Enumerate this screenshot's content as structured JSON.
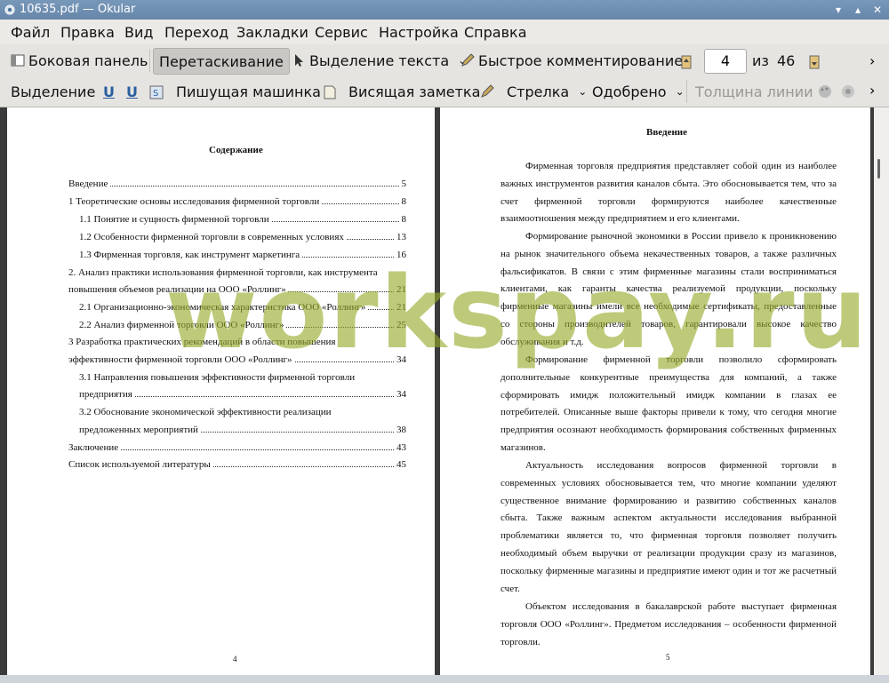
{
  "window": {
    "title": "10635.pdf — Okular"
  },
  "menubar": {
    "items": [
      "Файл",
      "Правка",
      "Вид",
      "Переход",
      "Закладки",
      "Сервис",
      "Настройка",
      "Справка"
    ]
  },
  "toolbar1": {
    "sidebar_label": "Боковая панель",
    "drag_label": "Перетаскивание",
    "text_select_label": "Выделение текста",
    "quick_comment_label": "Быстрое комментирование",
    "current_page": "4",
    "of_label": "из",
    "total_pages": "46"
  },
  "toolbar2": {
    "select_label": "Выделение",
    "typewriter_label": "Пишущая машинка",
    "sticky_note_label": "Висящая заметка",
    "arrow_label": "Стрелка",
    "approved_label": "Одобрено",
    "line_width_label": "Толщина линии"
  },
  "left_page": {
    "title": "Содержание",
    "toc": [
      {
        "text": "Введение",
        "page": "5"
      },
      {
        "text": "1    Теоретические основы исследования фирменной торговли",
        "page": "8"
      },
      {
        "text": "1.1 Понятие и сущность фирменной торговли",
        "page": "8"
      },
      {
        "text": "1.2 Особенности фирменной торговли в современных условиях",
        "page": "13"
      },
      {
        "text": "1.3 Фирменная торговля, как инструмент маркетинга",
        "page": "16"
      },
      {
        "text": "2. Анализ практики использования фирменной торговли, как инструмента",
        "page": ""
      },
      {
        "text": "повышения объемов реализации на ООО «Роллинг»",
        "page": "21"
      },
      {
        "text": "2.1 Организационно-экономическая характеристика ООО «Роллинг»",
        "page": "21"
      },
      {
        "text": "2.2 Анализ фирменной торговли ООО «Роллинг»",
        "page": "25"
      },
      {
        "text": "3    Разработка    практических    рекомендаций    в    области    повышения",
        "page": ""
      },
      {
        "text": "эффективности фирменной торговли ООО «Роллинг»",
        "page": "34"
      },
      {
        "text": "3.1    Направления    повышения    эффективности    фирменной    торговли",
        "page": ""
      },
      {
        "text": "предприятия",
        "page": "34"
      },
      {
        "text": "3.2    Обоснование    экономической    эффективности    реализации",
        "page": ""
      },
      {
        "text": "предложенных мероприятий",
        "page": "38"
      },
      {
        "text": "Заключение",
        "page": "43"
      },
      {
        "text": "Список используемой литературы",
        "page": "45"
      }
    ],
    "page_number": "4"
  },
  "right_page": {
    "title": "Введение",
    "paragraphs": [
      "Фирменная торговля предприятия представляет собой один из наиболее важных инструментов развития каналов сбыта. Это обосновывается тем, что за счет фирменной торговли формируются наиболее качественные взаимоотношения между предприятием и его клиентами.",
      "Формирование рыночной экономики в России привело к проникновению на рынок значительного объема некачественных товаров, а также различных фальсификатов. В связи с этим фирменные магазины стали восприниматься клиентами, как гаранты качества реализуемой продукции, поскольку фирменные магазины имели все необходимые сертификаты, предоставленные со стороны производителей товаров, гарантировали высокое качество обслуживания и т.д.",
      "Формирование фирменной торговли позволило сформировать дополнительные конкурентные преимущества для компаний, а также сформировать имидж положительный имидж компании в глазах ее потребителей. Описанные выше факторы привели к тому, что сегодня многие предприятия осознают необходимость формирования собственных фирменных магазинов.",
      "Актуальность исследования вопросов фирменной торговли в современных условиях обосновывается тем, что многие компании уделяют существенное внимание формированию и развитию собственных каналов сбыта. Также важным аспектом актуальности исследования выбранной проблематики является то, что фирменная торговля позволяет получить необходимый объем выручки от реализации продукции сразу из магазинов, поскольку фирменные магазины и предприятие имеют один и тот же расчетный счет.",
      "Объектом исследования в бакалаврской работе выступает фирменная торговля ООО «Роллинг». Предметом исследования – особенности фирменной торговли."
    ],
    "page_number": "5"
  },
  "watermark": "workspay.ru",
  "colors": {
    "titlebar": "#6f8fb1",
    "watermark": "#9bb02a"
  }
}
